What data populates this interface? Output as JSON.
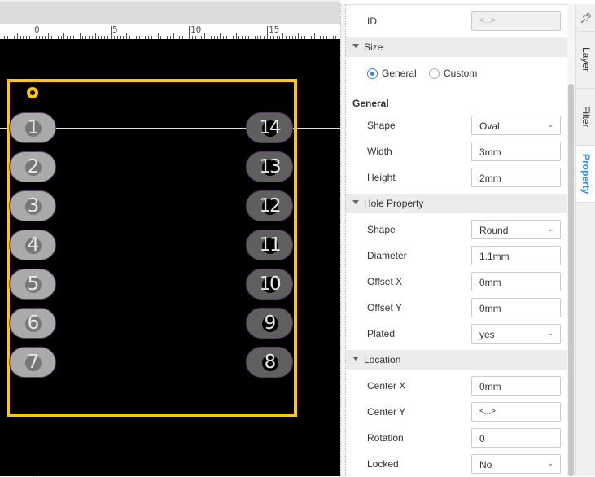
{
  "ruler": {
    "labels": [
      "0",
      "5",
      "10",
      "15"
    ]
  },
  "pads": {
    "left": [
      "1",
      "2",
      "3",
      "4",
      "5",
      "6",
      "7"
    ],
    "right": [
      "14",
      "13",
      "12",
      "11",
      "10",
      "9",
      "8"
    ]
  },
  "colors": {
    "outline": "#ffc800",
    "accent": "#2d8cf0"
  },
  "panel": {
    "id": {
      "label": "ID",
      "value": "<...>"
    },
    "size": {
      "title": "Size",
      "radio_general": "General",
      "radio_custom": "Custom",
      "selected": "General"
    },
    "general": {
      "heading": "General",
      "shape_label": "Shape",
      "shape_value": "Oval",
      "width_label": "Width",
      "width_value": "3mm",
      "height_label": "Height",
      "height_value": "2mm"
    },
    "hole": {
      "title": "Hole Property",
      "shape_label": "Shape",
      "shape_value": "Round",
      "diameter_label": "Diameter",
      "diameter_value": "1.1mm",
      "offx_label": "Offset X",
      "offx_value": "0mm",
      "offy_label": "Offset Y",
      "offy_value": "0mm",
      "plated_label": "Plated",
      "plated_value": "yes"
    },
    "location": {
      "title": "Location",
      "cx_label": "Center X",
      "cx_value": "0mm",
      "cy_label": "Center Y",
      "cy_value": "<...>",
      "rot_label": "Rotation",
      "rot_value": "0",
      "locked_label": "Locked",
      "locked_value": "No"
    }
  },
  "tabs": {
    "pin": "pin-icon",
    "layer": "Layer",
    "filter": "Filter",
    "property": "Property"
  }
}
